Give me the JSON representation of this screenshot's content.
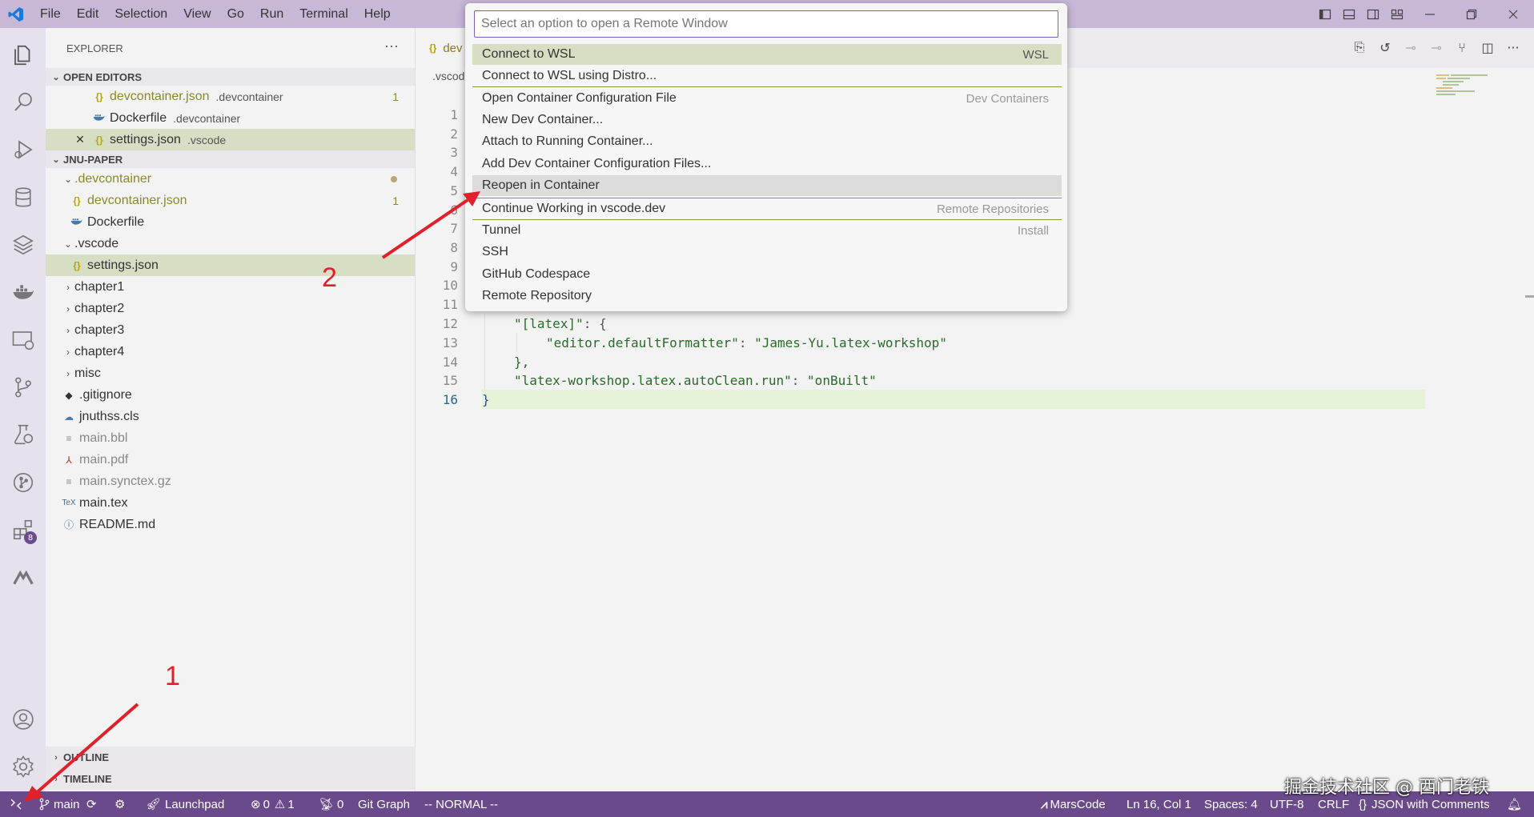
{
  "titlebar": {
    "menu": [
      "File",
      "Edit",
      "Selection",
      "View",
      "Go",
      "Run",
      "Terminal",
      "Help"
    ]
  },
  "activitybar": {
    "icons": [
      "explorer-icon",
      "search-icon",
      "run-debug-icon",
      "database-icon",
      "layers-icon",
      "docker-icon",
      "remote-explorer-icon",
      "source-control-icon",
      "testing-icon",
      "git-graph-icon",
      "extensions-icon",
      "marscode-icon",
      "account-icon",
      "settings-gear-icon"
    ],
    "extensions_badge": "8"
  },
  "sidebar": {
    "title": "EXPLORER",
    "open_editors_header": "OPEN EDITORS",
    "open_editors": [
      {
        "name": "devcontainer.json",
        "desc": ".devcontainer",
        "tail": "1"
      },
      {
        "name": "Dockerfile",
        "desc": ".devcontainer"
      },
      {
        "name": "settings.json",
        "desc": ".vscode"
      }
    ],
    "project_header": "JNU-PAPER",
    "tree": [
      {
        "name": ".devcontainer"
      },
      {
        "name": "devcontainer.json",
        "tail": "1"
      },
      {
        "name": "Dockerfile"
      },
      {
        "name": ".vscode"
      },
      {
        "name": "settings.json"
      },
      {
        "name": "chapter1"
      },
      {
        "name": "chapter2"
      },
      {
        "name": "chapter3"
      },
      {
        "name": "chapter4"
      },
      {
        "name": "misc"
      },
      {
        "name": ".gitignore"
      },
      {
        "name": "jnuthss.cls"
      },
      {
        "name": "main.bbl"
      },
      {
        "name": "main.pdf"
      },
      {
        "name": "main.synctex.gz"
      },
      {
        "name": "main.tex"
      },
      {
        "name": "README.md"
      }
    ],
    "outline": "OUTLINE",
    "timeline": "TIMELINE"
  },
  "editor": {
    "tab_label": "dev",
    "breadcrumb": ".vscod",
    "line_numbers": [
      "1",
      "2",
      "3",
      "4",
      "5",
      "6",
      "7",
      "8",
      "9",
      "10",
      "11",
      "12",
      "13",
      "14",
      "15",
      "16"
    ],
    "visible_code": {
      "l12_key": "\"[latex]\"",
      "l12_rest": ": {",
      "l13_key": "\"editor.defaultFormatter\"",
      "l13_colon": ": ",
      "l13_val": "\"James-Yu.latex-workshop\"",
      "l14": "},",
      "l15_key": "\"latex-workshop.latex.autoClean.run\"",
      "l15_colon": ": ",
      "l15_val": "\"onBuilt\"",
      "l16": "}"
    }
  },
  "quickpick": {
    "placeholder": "Select an option to open a Remote Window",
    "items": [
      {
        "label": "Connect to WSL",
        "right": "WSL"
      },
      {
        "label": "Connect to WSL using Distro...",
        "right": ""
      },
      {
        "label": "Open Container Configuration File",
        "right": "Dev Containers"
      },
      {
        "label": "New Dev Container...",
        "right": ""
      },
      {
        "label": "Attach to Running Container...",
        "right": ""
      },
      {
        "label": "Add Dev Container Configuration Files...",
        "right": ""
      },
      {
        "label": "Reopen in Container",
        "right": ""
      },
      {
        "label": "Continue Working in vscode.dev",
        "right": "Remote Repositories"
      },
      {
        "label": "Tunnel",
        "right": "Install"
      },
      {
        "label": "SSH",
        "right": ""
      },
      {
        "label": "GitHub Codespace",
        "right": ""
      },
      {
        "label": "Remote Repository",
        "right": ""
      }
    ]
  },
  "statusbar": {
    "branch": "main",
    "launchpad": "Launchpad",
    "errors": "0",
    "warnings": "1",
    "ports": "0",
    "git_graph": "Git Graph",
    "mode": "-- NORMAL --",
    "marscode": "MarsCode",
    "position": "Ln 16, Col 1",
    "spaces": "Spaces: 4",
    "encoding": "UTF-8",
    "eol": "CRLF",
    "language": "JSON with Comments"
  },
  "annotations": {
    "label_1": "1",
    "label_2": "2",
    "watermark": "掘金技术社区 @ 西门老铁"
  },
  "colors": {
    "statusbar_bg": "#6a4a8a",
    "titlebar_bg": "#c8b8d8",
    "selection_green": "#d6dfc4",
    "annotation_red": "#e0202a"
  }
}
